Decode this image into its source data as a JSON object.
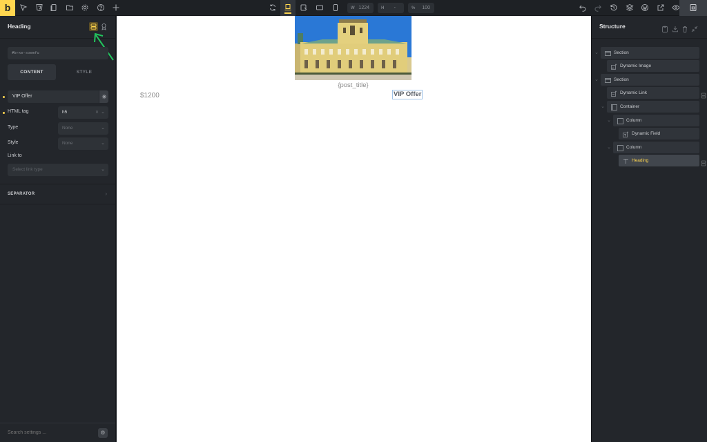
{
  "topbar": {
    "logo": "b",
    "left_icons": [
      "cursor-icon",
      "css3-icon",
      "pages-icon",
      "folder-icon",
      "gear-icon",
      "help-icon",
      "plus-icon"
    ],
    "center_icons": [
      "refresh-icon",
      "desktop-icon",
      "tablet-landscape-icon",
      "tablet-icon",
      "mobile-icon"
    ],
    "width": {
      "label": "W",
      "value": "1224"
    },
    "height": {
      "label": "H",
      "value": "-"
    },
    "zoom": {
      "label": "%",
      "value": "100"
    },
    "right_icons": [
      "undo-icon",
      "redo-icon",
      "history-icon",
      "layers-icon",
      "wordpress-icon",
      "external-link-icon",
      "eye-icon",
      "save-icon"
    ]
  },
  "left_panel": {
    "title": "Heading",
    "element_id": "#brxe-soemfu",
    "tabs": [
      {
        "label": "CONTENT",
        "active": true
      },
      {
        "label": "STYLE",
        "active": false
      }
    ],
    "text_value": "VIP Offer",
    "fields": [
      {
        "label": "HTML tag",
        "value": "h5",
        "placeholder": "",
        "has_clear": true
      },
      {
        "label": "Type",
        "value": "",
        "placeholder": "None"
      },
      {
        "label": "Style",
        "value": "",
        "placeholder": "None"
      }
    ],
    "link_to": {
      "label": "Link to",
      "placeholder": "Select link type"
    },
    "separator": "SEPARATOR",
    "search_placeholder": "Search settings ..."
  },
  "canvas": {
    "post_title": "{post_title}",
    "price": "$1200",
    "heading": "VIP Offer"
  },
  "structure": {
    "title": "Structure",
    "nodes": [
      {
        "label": "Section",
        "icon": "section-icon",
        "level": 0,
        "toggle": true,
        "active": false
      },
      {
        "label": "Dynamic Image",
        "icon": "dynamic-image-icon",
        "level": 1,
        "toggle": false,
        "active": false
      },
      {
        "label": "Section",
        "icon": "section-icon",
        "level": 0,
        "toggle": true,
        "active": false
      },
      {
        "label": "Dynamic Link",
        "icon": "dynamic-link-icon",
        "level": 1,
        "toggle": false,
        "active": false
      },
      {
        "label": "Container",
        "icon": "container-icon",
        "level": 1,
        "toggle": true,
        "active": false
      },
      {
        "label": "Column",
        "icon": "column-icon",
        "level": 2,
        "toggle": true,
        "active": false
      },
      {
        "label": "Dynamic Field",
        "icon": "dynamic-field-icon",
        "level": 3,
        "toggle": false,
        "active": false
      },
      {
        "label": "Column",
        "icon": "column-icon",
        "level": 2,
        "toggle": true,
        "active": false
      },
      {
        "label": "Heading",
        "icon": "heading-icon",
        "level": 3,
        "toggle": false,
        "active": true
      }
    ]
  },
  "colors": {
    "accent": "#ffd64f",
    "panel_bg": "#23262b",
    "annotation_arrow": "#22c55e"
  }
}
